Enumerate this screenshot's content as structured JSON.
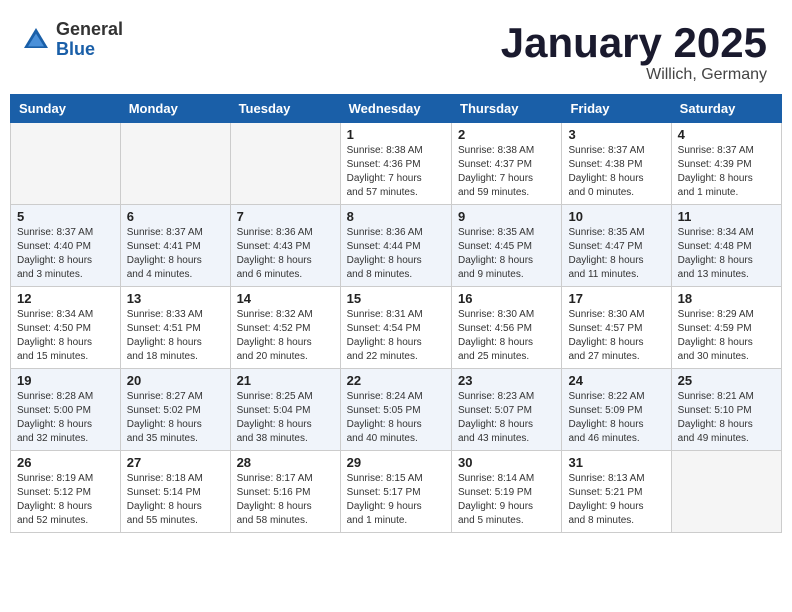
{
  "logo": {
    "general": "General",
    "blue": "Blue"
  },
  "header": {
    "title": "January 2025",
    "subtitle": "Willich, Germany"
  },
  "weekdays": [
    "Sunday",
    "Monday",
    "Tuesday",
    "Wednesday",
    "Thursday",
    "Friday",
    "Saturday"
  ],
  "weeks": [
    [
      {
        "day": "",
        "info": ""
      },
      {
        "day": "",
        "info": ""
      },
      {
        "day": "",
        "info": ""
      },
      {
        "day": "1",
        "info": "Sunrise: 8:38 AM\nSunset: 4:36 PM\nDaylight: 7 hours\nand 57 minutes."
      },
      {
        "day": "2",
        "info": "Sunrise: 8:38 AM\nSunset: 4:37 PM\nDaylight: 7 hours\nand 59 minutes."
      },
      {
        "day": "3",
        "info": "Sunrise: 8:37 AM\nSunset: 4:38 PM\nDaylight: 8 hours\nand 0 minutes."
      },
      {
        "day": "4",
        "info": "Sunrise: 8:37 AM\nSunset: 4:39 PM\nDaylight: 8 hours\nand 1 minute."
      }
    ],
    [
      {
        "day": "5",
        "info": "Sunrise: 8:37 AM\nSunset: 4:40 PM\nDaylight: 8 hours\nand 3 minutes."
      },
      {
        "day": "6",
        "info": "Sunrise: 8:37 AM\nSunset: 4:41 PM\nDaylight: 8 hours\nand 4 minutes."
      },
      {
        "day": "7",
        "info": "Sunrise: 8:36 AM\nSunset: 4:43 PM\nDaylight: 8 hours\nand 6 minutes."
      },
      {
        "day": "8",
        "info": "Sunrise: 8:36 AM\nSunset: 4:44 PM\nDaylight: 8 hours\nand 8 minutes."
      },
      {
        "day": "9",
        "info": "Sunrise: 8:35 AM\nSunset: 4:45 PM\nDaylight: 8 hours\nand 9 minutes."
      },
      {
        "day": "10",
        "info": "Sunrise: 8:35 AM\nSunset: 4:47 PM\nDaylight: 8 hours\nand 11 minutes."
      },
      {
        "day": "11",
        "info": "Sunrise: 8:34 AM\nSunset: 4:48 PM\nDaylight: 8 hours\nand 13 minutes."
      }
    ],
    [
      {
        "day": "12",
        "info": "Sunrise: 8:34 AM\nSunset: 4:50 PM\nDaylight: 8 hours\nand 15 minutes."
      },
      {
        "day": "13",
        "info": "Sunrise: 8:33 AM\nSunset: 4:51 PM\nDaylight: 8 hours\nand 18 minutes."
      },
      {
        "day": "14",
        "info": "Sunrise: 8:32 AM\nSunset: 4:52 PM\nDaylight: 8 hours\nand 20 minutes."
      },
      {
        "day": "15",
        "info": "Sunrise: 8:31 AM\nSunset: 4:54 PM\nDaylight: 8 hours\nand 22 minutes."
      },
      {
        "day": "16",
        "info": "Sunrise: 8:30 AM\nSunset: 4:56 PM\nDaylight: 8 hours\nand 25 minutes."
      },
      {
        "day": "17",
        "info": "Sunrise: 8:30 AM\nSunset: 4:57 PM\nDaylight: 8 hours\nand 27 minutes."
      },
      {
        "day": "18",
        "info": "Sunrise: 8:29 AM\nSunset: 4:59 PM\nDaylight: 8 hours\nand 30 minutes."
      }
    ],
    [
      {
        "day": "19",
        "info": "Sunrise: 8:28 AM\nSunset: 5:00 PM\nDaylight: 8 hours\nand 32 minutes."
      },
      {
        "day": "20",
        "info": "Sunrise: 8:27 AM\nSunset: 5:02 PM\nDaylight: 8 hours\nand 35 minutes."
      },
      {
        "day": "21",
        "info": "Sunrise: 8:25 AM\nSunset: 5:04 PM\nDaylight: 8 hours\nand 38 minutes."
      },
      {
        "day": "22",
        "info": "Sunrise: 8:24 AM\nSunset: 5:05 PM\nDaylight: 8 hours\nand 40 minutes."
      },
      {
        "day": "23",
        "info": "Sunrise: 8:23 AM\nSunset: 5:07 PM\nDaylight: 8 hours\nand 43 minutes."
      },
      {
        "day": "24",
        "info": "Sunrise: 8:22 AM\nSunset: 5:09 PM\nDaylight: 8 hours\nand 46 minutes."
      },
      {
        "day": "25",
        "info": "Sunrise: 8:21 AM\nSunset: 5:10 PM\nDaylight: 8 hours\nand 49 minutes."
      }
    ],
    [
      {
        "day": "26",
        "info": "Sunrise: 8:19 AM\nSunset: 5:12 PM\nDaylight: 8 hours\nand 52 minutes."
      },
      {
        "day": "27",
        "info": "Sunrise: 8:18 AM\nSunset: 5:14 PM\nDaylight: 8 hours\nand 55 minutes."
      },
      {
        "day": "28",
        "info": "Sunrise: 8:17 AM\nSunset: 5:16 PM\nDaylight: 8 hours\nand 58 minutes."
      },
      {
        "day": "29",
        "info": "Sunrise: 8:15 AM\nSunset: 5:17 PM\nDaylight: 9 hours\nand 1 minute."
      },
      {
        "day": "30",
        "info": "Sunrise: 8:14 AM\nSunset: 5:19 PM\nDaylight: 9 hours\nand 5 minutes."
      },
      {
        "day": "31",
        "info": "Sunrise: 8:13 AM\nSunset: 5:21 PM\nDaylight: 9 hours\nand 8 minutes."
      },
      {
        "day": "",
        "info": ""
      }
    ]
  ]
}
